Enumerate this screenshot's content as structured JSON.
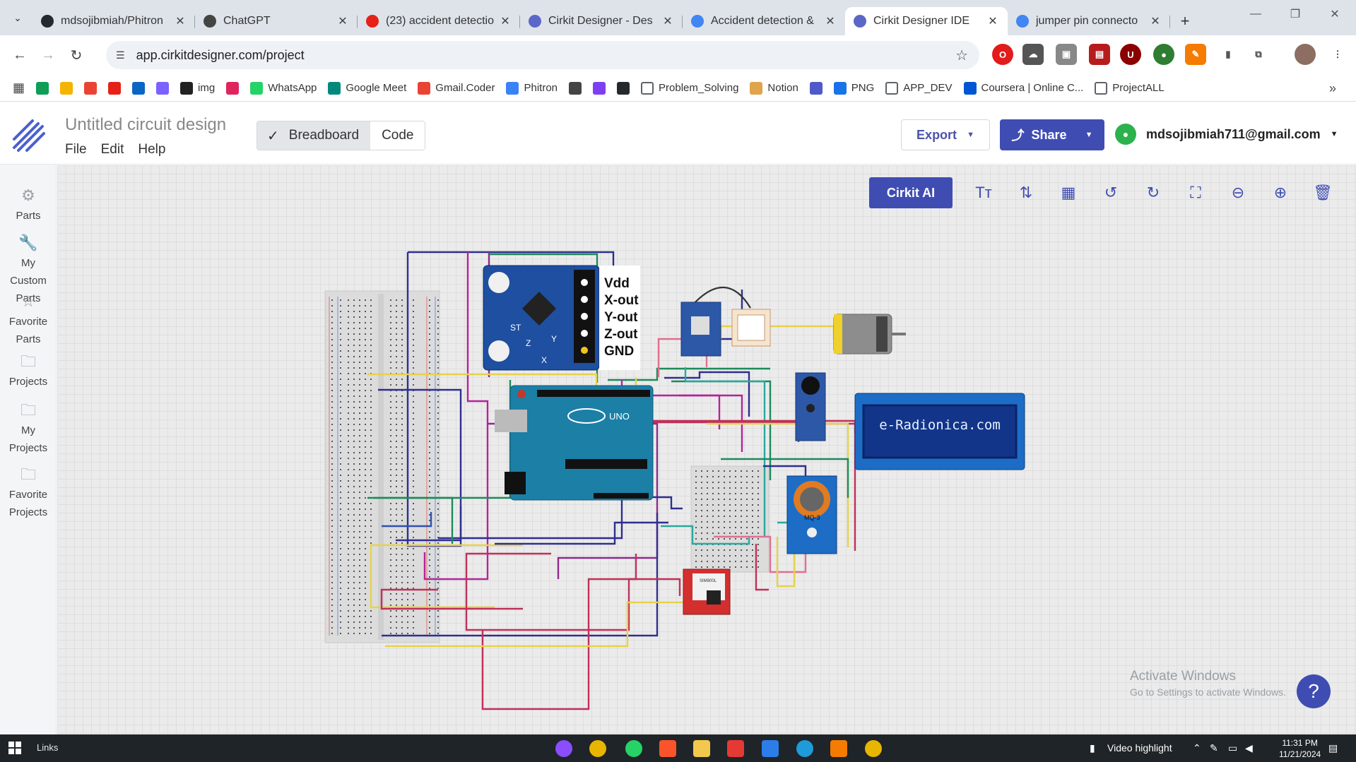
{
  "browser": {
    "tabs": [
      {
        "title": "mdsojibmiah/Phitron",
        "icon": "github-icon",
        "color": "#24292e"
      },
      {
        "title": "ChatGPT",
        "icon": "chatgpt-icon",
        "color": "#444444"
      },
      {
        "title": "(23) accident detectio",
        "icon": "youtube-icon",
        "color": "#e62117"
      },
      {
        "title": "Cirkit Designer - Des",
        "icon": "cirkit-icon",
        "color": "#5b67c7"
      },
      {
        "title": "Accident detection &",
        "icon": "docs-icon",
        "color": "#4285f4"
      },
      {
        "title": "Cirkit Designer IDE",
        "icon": "cirkit-icon",
        "color": "#5b67c7",
        "active": true
      },
      {
        "title": "jumper pin connecto",
        "icon": "google-icon",
        "color": "#4285f4"
      }
    ],
    "url": "app.cirkitdesigner.com/project"
  },
  "bookmarks": [
    {
      "label": "",
      "icon": "sheets-icon",
      "color": "#0f9d58"
    },
    {
      "label": "",
      "icon": "classroom-icon",
      "color": "#f4b400"
    },
    {
      "label": "",
      "icon": "gmail-icon",
      "color": "#ea4335"
    },
    {
      "label": "",
      "icon": "youtube-icon",
      "color": "#e62117"
    },
    {
      "label": "",
      "icon": "linkedin-icon",
      "color": "#0a66c2"
    },
    {
      "label": "",
      "icon": "copilot-icon",
      "color": "#7b61ff"
    },
    {
      "label": "img",
      "icon": "img-icon",
      "color": "#222222"
    },
    {
      "label": "",
      "icon": "bars-icon",
      "color": "#e0245e"
    },
    {
      "label": "WhatsApp",
      "icon": "whatsapp-icon",
      "color": "#25d366"
    },
    {
      "label": "Google Meet",
      "icon": "meet-icon",
      "color": "#00897b"
    },
    {
      "label": "Gmail.Coder",
      "icon": "gmail-icon",
      "color": "#ea4335"
    },
    {
      "label": "Phitron",
      "icon": "phitron-icon",
      "color": "#3b82f6"
    },
    {
      "label": "",
      "icon": "chatgpt-icon",
      "color": "#444444"
    },
    {
      "label": "",
      "icon": "play-icon",
      "color": "#7e3ff2"
    },
    {
      "label": "",
      "icon": "github-icon",
      "color": "#24292e"
    },
    {
      "label": "Problem_Solving",
      "icon": "folder-icon",
      "color": "#5f6368"
    },
    {
      "label": "Notion",
      "icon": "notion-icon",
      "color": "#e0a44b"
    },
    {
      "label": "",
      "icon": "teams-icon",
      "color": "#5059c9"
    },
    {
      "label": "PNG",
      "icon": "png-icon",
      "color": "#1a73e8"
    },
    {
      "label": "APP_DEV",
      "icon": "folder-icon",
      "color": "#5f6368"
    },
    {
      "label": "Coursera | Online C...",
      "icon": "coursera-icon",
      "color": "#0056d2"
    },
    {
      "label": "ProjectALL",
      "icon": "folder-icon",
      "color": "#5f6368"
    }
  ],
  "app": {
    "project_name": "Untitled circuit design",
    "menu": [
      "File",
      "Edit",
      "Help"
    ],
    "view_breadboard": "Breadboard",
    "view_code": "Code",
    "export_label": "Export",
    "share_label": "Share",
    "account": "mdsojibmiah711@gmail.com",
    "cirkit_ai": "Cirkit AI",
    "brand_color": "#3f4db3"
  },
  "sidenav": [
    {
      "label": "Parts",
      "icon": "parts-icon"
    },
    {
      "label": "My Custom Parts",
      "icon": "wrench-icon"
    },
    {
      "label": "Favorite Parts",
      "icon": "star-icon"
    },
    {
      "label": "Projects",
      "icon": "folder-icon"
    },
    {
      "label": "My Projects",
      "icon": "user-folder-icon"
    },
    {
      "label": "Favorite Projects",
      "icon": "star-folder-icon"
    }
  ],
  "toolbar": [
    "text-icon",
    "flip-icon",
    "grid-icon",
    "rotate-left-icon",
    "rotate-right-icon",
    "fit-screen-icon",
    "zoom-out-icon",
    "zoom-in-icon",
    "delete-icon"
  ],
  "circuit": {
    "accelerometer_pins": [
      "Vdd",
      "X-out",
      "Y-out",
      "Z-out",
      "GND"
    ],
    "accel_axes": [
      "ST",
      "Z",
      "Y",
      "X"
    ],
    "arduino_label": "UNO",
    "lcd_text": "e-Radionica.com",
    "mq_label": "MQ-3",
    "gsm_label": "SIM800L"
  },
  "watermark": {
    "line1": "Activate Windows",
    "line2": "Go to Settings to activate Windows."
  },
  "taskbar": {
    "links": "Links",
    "video_highlight": "Video highlight",
    "time": "11:31 PM",
    "date": "11/21/2024"
  }
}
